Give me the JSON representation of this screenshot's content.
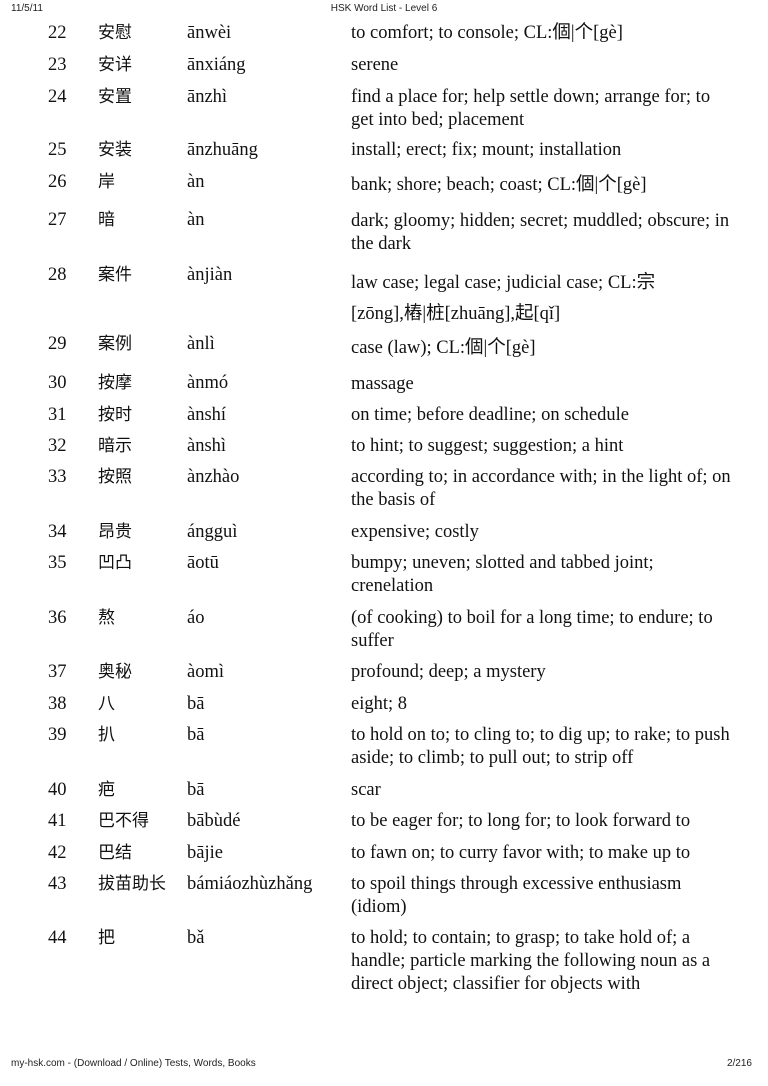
{
  "header": {
    "date": "11/5/11",
    "title": "HSK Word List - Level 6"
  },
  "footer": {
    "source": "my-hsk.com - (Download / Online) Tests, Words, Books",
    "page": "2/216"
  },
  "entries": [
    {
      "num": "22",
      "hanzi": "安慰",
      "pinyin": "ānwèi",
      "definition": "to comfort; to console; CL:個|个[gè]"
    },
    {
      "num": "23",
      "hanzi": "安详",
      "pinyin": "ānxiáng",
      "definition": "serene"
    },
    {
      "num": "24",
      "hanzi": "安置",
      "pinyin": "ānzhì",
      "definition": "find a place for; help settle down; arrange for; to get into bed; placement"
    },
    {
      "num": "25",
      "hanzi": "安装",
      "pinyin": "ānzhuāng",
      "definition": "install; erect; fix; mount; installation"
    },
    {
      "num": "26",
      "hanzi": "岸",
      "pinyin": "àn",
      "definition": "bank; shore; beach; coast; CL:個|个[gè]"
    },
    {
      "num": "27",
      "hanzi": "暗",
      "pinyin": "àn",
      "definition": "dark; gloomy; hidden; secret; muddled; obscure; in the dark"
    },
    {
      "num": "28",
      "hanzi": "案件",
      "pinyin": "ànjiàn",
      "definition": "law case; legal case; judicial case; CL:宗[zōng],樁|桩[zhuāng],起[qǐ]"
    },
    {
      "num": "29",
      "hanzi": "案例",
      "pinyin": "ànlì",
      "definition": "case (law); CL:個|个[gè]"
    },
    {
      "num": "30",
      "hanzi": "按摩",
      "pinyin": "ànmó",
      "definition": "massage"
    },
    {
      "num": "31",
      "hanzi": "按时",
      "pinyin": "ànshí",
      "definition": "on time; before deadline; on schedule"
    },
    {
      "num": "32",
      "hanzi": "暗示",
      "pinyin": "ànshì",
      "definition": "to hint; to suggest; suggestion; a hint"
    },
    {
      "num": "33",
      "hanzi": "按照",
      "pinyin": "ànzhào",
      "definition": "according to; in accordance with; in the light of; on the basis of"
    },
    {
      "num": "34",
      "hanzi": "昂贵",
      "pinyin": "ángguì",
      "definition": "expensive; costly"
    },
    {
      "num": "35",
      "hanzi": "凹凸",
      "pinyin": "āotū",
      "definition": "bumpy; uneven; slotted and tabbed joint; crenelation"
    },
    {
      "num": "36",
      "hanzi": "熬",
      "pinyin": "áo",
      "definition": "(of cooking) to boil for a long time; to endure; to suffer"
    },
    {
      "num": "37",
      "hanzi": "奥秘",
      "pinyin": "àomì",
      "definition": "profound; deep; a mystery"
    },
    {
      "num": "38",
      "hanzi": "八",
      "pinyin": "bā",
      "definition": "eight; 8"
    },
    {
      "num": "39",
      "hanzi": "扒",
      "pinyin": "bā",
      "definition": "to hold on to; to cling to; to dig up; to rake; to push aside; to climb; to pull out; to strip off"
    },
    {
      "num": "40",
      "hanzi": "疤",
      "pinyin": "bā",
      "definition": "scar"
    },
    {
      "num": "41",
      "hanzi": "巴不得",
      "pinyin": "bābùdé",
      "definition": "to be eager for; to long for; to look forward to"
    },
    {
      "num": "42",
      "hanzi": "巴结",
      "pinyin": "bājie",
      "definition": "to fawn on; to curry favor with; to make up to"
    },
    {
      "num": "43",
      "hanzi": "拔苗助长",
      "pinyin": "bámiáozhùzhǎng",
      "definition": "to spoil things through excessive enthusiasm (idiom)"
    },
    {
      "num": "44",
      "hanzi": "把",
      "pinyin": "bǎ",
      "definition": "to hold; to contain; to grasp; to take hold of; a handle; particle marking the following noun as a direct object; classifier for objects with"
    }
  ]
}
